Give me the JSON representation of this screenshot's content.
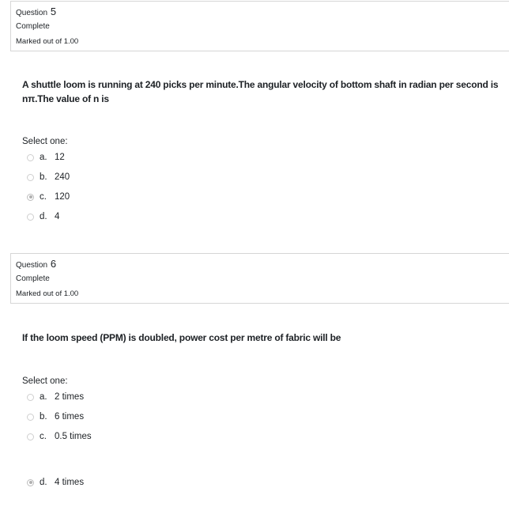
{
  "questions": [
    {
      "label": "Question",
      "number": "5",
      "state": "Complete",
      "grade": "Marked out of 1.00",
      "text_lines": [
        "A shuttle loom is running at 240 picks per minute.The angular velocity of bottom shaft in radian per second is",
        "nπ.The value of n is"
      ],
      "prompt": "Select one:",
      "options": [
        {
          "letter": "a.",
          "text": "12",
          "selected": false
        },
        {
          "letter": "b.",
          "text": "240",
          "selected": false
        },
        {
          "letter": "c.",
          "text": "120",
          "selected": true
        },
        {
          "letter": "d.",
          "text": "4",
          "selected": false
        }
      ]
    },
    {
      "label": "Question",
      "number": "6",
      "state": "Complete",
      "grade": "Marked out of 1.00",
      "text_lines": [
        "If the loom speed (PPM) is doubled, power cost per metre of fabric will be"
      ],
      "prompt": "Select one:",
      "options": [
        {
          "letter": "a.",
          "text": "2 times",
          "selected": false
        },
        {
          "letter": "b.",
          "text": "6 times",
          "selected": false
        },
        {
          "letter": "c.",
          "text": "0.5 times",
          "selected": false
        },
        {
          "letter": "d.",
          "text": "4 times",
          "selected": true
        }
      ]
    }
  ],
  "colors": {
    "text": "#1d2125",
    "border": "#d6d6d6",
    "radio_selected": "#b0b0b0"
  }
}
